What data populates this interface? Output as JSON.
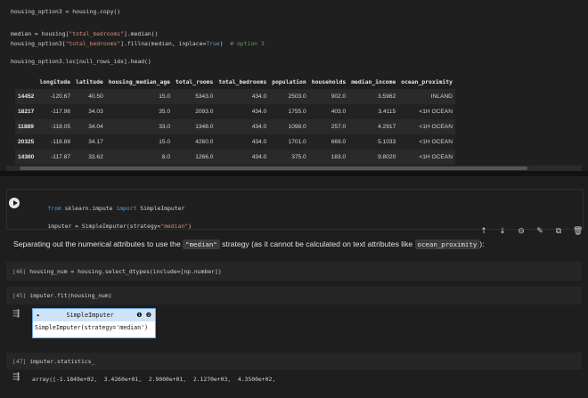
{
  "top_cell": {
    "lines": [
      "housing_option3 = housing.copy()",
      "median = housing[\"total_bedrooms\"].median()",
      "housing_option3[\"total_bedrooms\"].fillna(median, inplace=True)  # option 3",
      "housing_option3.loc[null_rows_idx].head()"
    ]
  },
  "dataframe": {
    "columns": [
      "",
      "longitude",
      "latitude",
      "housing_median_age",
      "total_rooms",
      "total_bedrooms",
      "population",
      "households",
      "median_income",
      "ocean_proximity"
    ],
    "rows": [
      [
        "14452",
        "-120.67",
        "40.50",
        "15.0",
        "5343.0",
        "434.0",
        "2503.0",
        "902.0",
        "3.5962",
        "INLAND"
      ],
      [
        "18217",
        "-117.96",
        "34.03",
        "35.0",
        "2093.0",
        "434.0",
        "1755.0",
        "403.0",
        "3.4115",
        "<1H OCEAN"
      ],
      [
        "11889",
        "-118.05",
        "34.04",
        "33.0",
        "1348.0",
        "434.0",
        "1098.0",
        "257.0",
        "4.2917",
        "<1H OCEAN"
      ],
      [
        "20325",
        "-118.88",
        "34.17",
        "15.0",
        "4260.0",
        "434.0",
        "1701.0",
        "669.0",
        "5.1033",
        "<1H OCEAN"
      ],
      [
        "14360",
        "-117.87",
        "33.62",
        "8.0",
        "1266.0",
        "434.0",
        "375.0",
        "183.0",
        "9.8020",
        "<1H OCEAN"
      ]
    ]
  },
  "cell_import": {
    "line1_kw1": "from",
    "line1_mod": " sklearn.impute ",
    "line1_kw2": "import",
    "line1_rest": " SimpleImputer",
    "line2_pre": "imputer = SimpleImputer(strategy=",
    "line2_str": "\"median\"",
    "line2_post": ")"
  },
  "toolbar": {
    "icons": [
      "↑",
      "↓",
      "⊖",
      "✎",
      "⧉",
      "🗑",
      "⋮"
    ]
  },
  "markdown": {
    "pre": "Separating out the numerical attributes to use the ",
    "code1": "\"median\"",
    "mid": " strategy (as it cannot be calculated on text attributes like ",
    "code2": "ocean_proximity",
    "post": "):"
  },
  "cell46": {
    "prompt": "[46]",
    "code": "housing_num = housing.select_dtypes(include=[np.number])"
  },
  "cell45": {
    "prompt": "[45]",
    "code": "imputer.fit(housing_num)"
  },
  "estimator": {
    "arrow": "▸",
    "name": "SimpleImputer",
    "info": "❶ ❷",
    "repr": "SimpleImputer(strategy='median')"
  },
  "cell47": {
    "prompt": "[47]",
    "code": "imputer.statistics_"
  },
  "output47": {
    "text": "array([-1.1849e+02,  3.4260e+01,  2.9000e+01,  2.1270e+03,  4.3500e+02,"
  }
}
